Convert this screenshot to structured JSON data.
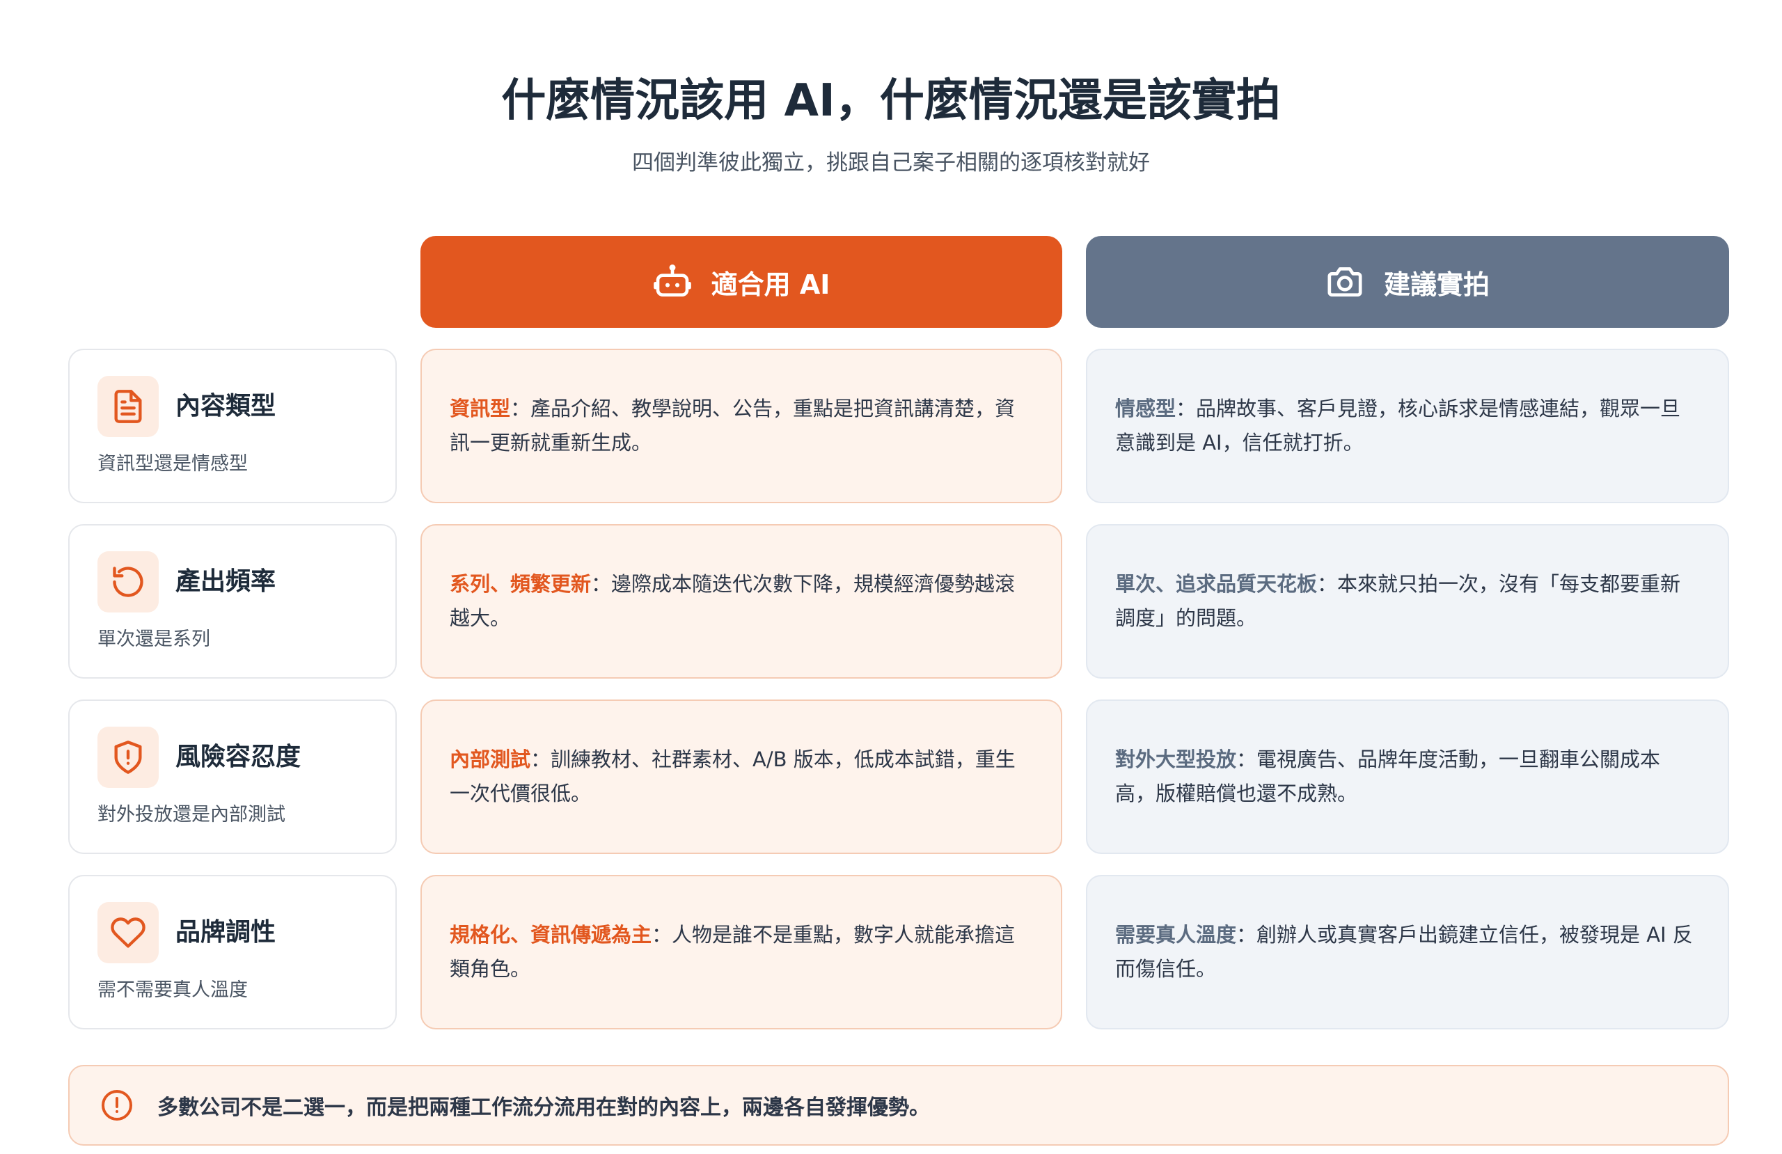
{
  "header": {
    "title": "什麼情況該用 AI，什麼情況還是該實拍",
    "subtitle": "四個判準彼此獨立，挑跟自己案子相關的逐項核對就好"
  },
  "columns": {
    "ai": {
      "label": "適合用 AI",
      "icon": "robot-icon",
      "color": "#e2571f"
    },
    "real": {
      "label": "建議實拍",
      "icon": "camera-icon",
      "color": "#64748b"
    }
  },
  "rows": [
    {
      "name": "內容類型",
      "desc": "資訊型還是情感型",
      "icon": "document-icon",
      "ai_kw": "資訊型",
      "ai_text": "：產品介紹、教學說明、公告，重點是把資訊講清楚，資訊一更新就重新生成。",
      "real_kw": "情感型",
      "real_text": "：品牌故事、客戶見證，核心訴求是情感連結，觀眾一旦意識到是 AI，信任就打折。"
    },
    {
      "name": "產出頻率",
      "desc": "單次還是系列",
      "icon": "refresh-icon",
      "ai_kw": "系列、頻繁更新",
      "ai_text": "：邊際成本隨迭代次數下降，規模經濟優勢越滾越大。",
      "real_kw": "單次、追求品質天花板",
      "real_text": "：本來就只拍一次，沒有「每支都要重新調度」的問題。"
    },
    {
      "name": "風險容忍度",
      "desc": "對外投放還是內部測試",
      "icon": "shield-alert-icon",
      "ai_kw": "內部測試",
      "ai_text": "：訓練教材、社群素材、A/B 版本，低成本試錯，重生一次代價很低。",
      "real_kw": "對外大型投放",
      "real_text": "：電視廣告、品牌年度活動，一旦翻車公關成本高，版權賠償也還不成熟。"
    },
    {
      "name": "品牌調性",
      "desc": "需不需要真人溫度",
      "icon": "heart-icon",
      "ai_kw": "規格化、資訊傳遞為主",
      "ai_text": "：人物是誰不是重點，數字人就能承擔這類角色。",
      "real_kw": "需要真人溫度",
      "real_text": "：創辦人或真實客戶出鏡建立信任，被發現是 AI 反而傷信任。"
    }
  ],
  "note": {
    "icon": "alert-circle-icon",
    "text": "多數公司不是二選一，而是把兩種工作流分流用在對的內容上，兩邊各自發揮優勢。"
  }
}
